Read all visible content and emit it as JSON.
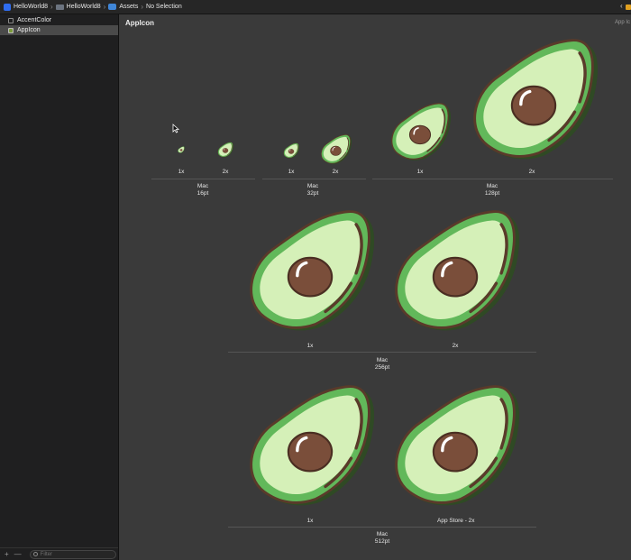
{
  "breadcrumb": {
    "project": "HelloWorld8",
    "folder": "HelloWorld8",
    "catalog": "Assets",
    "selection": "No Selection"
  },
  "sidebar": {
    "items": [
      {
        "label": "AccentColor",
        "icon": "color-swatch-icon"
      },
      {
        "label": "AppIcon",
        "icon": "app-icon-set-icon",
        "selected": true
      }
    ],
    "footer": {
      "add": "+",
      "remove": "—",
      "filter_placeholder": "Filter"
    }
  },
  "editor": {
    "title": "AppIcon",
    "corner_label": "App Ic",
    "groups": [
      {
        "platform": "Mac",
        "size": "16pt",
        "slots": [
          "1x",
          "2x"
        ]
      },
      {
        "platform": "Mac",
        "size": "32pt",
        "slots": [
          "1x",
          "2x"
        ]
      },
      {
        "platform": "Mac",
        "size": "128pt",
        "slots": [
          "1x",
          "2x"
        ]
      },
      {
        "platform": "Mac",
        "size": "256pt",
        "slots": [
          "1x",
          "2x"
        ]
      },
      {
        "platform": "Mac",
        "size": "512pt",
        "slots": [
          "1x",
          "App Store - 2x"
        ]
      }
    ]
  },
  "colors": {
    "avocado_skin": "#2f4a24",
    "avocado_ring": "#62b85a",
    "avocado_flesh": "#d5f0b8",
    "avocado_pit": "#7a4e3a",
    "outline": "#5a3a2a"
  }
}
